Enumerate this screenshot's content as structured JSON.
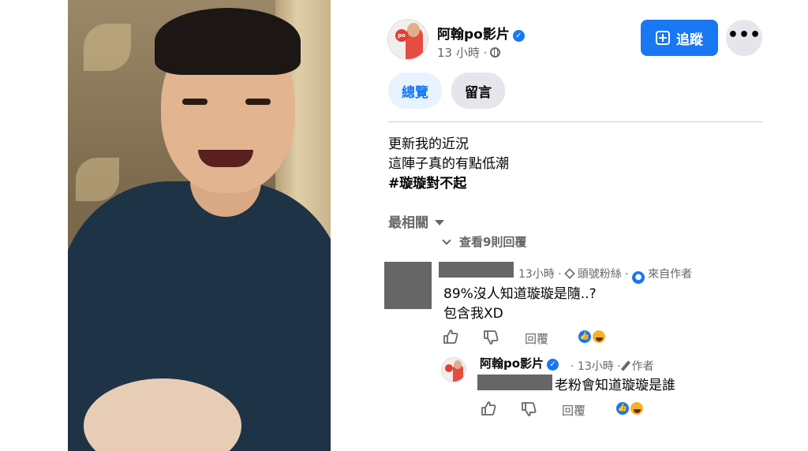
{
  "post": {
    "page_name": "阿翰po影片",
    "time": "13 小時 ·",
    "follow_label": "追蹤",
    "more_label": "•••",
    "tabs": [
      {
        "label": "總覽",
        "active": true
      },
      {
        "label": "留言",
        "active": false
      }
    ],
    "caption": [
      "更新我的近況",
      "這陣子真的有點低潮",
      "#璇璇對不起"
    ]
  },
  "comments": {
    "sort_label": "最相關",
    "view_replies": "查看9則回覆",
    "first": {
      "time": "13小時",
      "badge": "頭號粉絲",
      "from_author": "來自作者",
      "lines": [
        "89%沒人知道璇璇是隨..?",
        "包含我XD"
      ],
      "reply_label": "回覆"
    },
    "reply": {
      "name": "阿翰po影片",
      "time": "13小時",
      "author_label": "作者",
      "text": "老粉會知道璇璇是誰",
      "reply_label": "回覆"
    }
  },
  "icons": [
    "verified-icon",
    "globe-icon",
    "follow-icon",
    "diamond-icon",
    "author-icon",
    "pencil-icon",
    "thumbs-up-icon",
    "thumbs-down-icon",
    "like-reaction-icon",
    "haha-reaction-icon"
  ],
  "colors": {
    "accent": "#1877f2",
    "muted": "#65676b",
    "redaction": "#666666"
  }
}
